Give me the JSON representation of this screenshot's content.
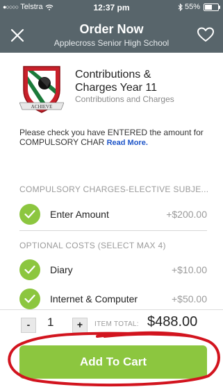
{
  "status": {
    "carrier": "Telstra",
    "time": "12:37 pm",
    "battery": "55%",
    "battery_level": 0.55
  },
  "header": {
    "title": "Order Now",
    "subtitle": "Applecross Senior High School"
  },
  "product": {
    "title_line1": "Contributions &",
    "title_line2": "Charges Year 11",
    "subtitle": "Contributions and Charges",
    "logo_text": "ACHIEVE"
  },
  "notice": {
    "text": "Please check you have ENTERED the amount for COMPULSORY CHAR ",
    "read_more": "Read More."
  },
  "sections": [
    {
      "title": "COMPULSORY CHARGES-ELECTIVE SUBJE..."
    },
    {
      "title": "OPTIONAL COSTS (SELECT MAX 4)"
    }
  ],
  "items": [
    {
      "label": "Enter Amount",
      "price": "+$200.00"
    },
    {
      "label": "Diary",
      "price": "+$10.00"
    },
    {
      "label": "Internet & Computer",
      "price": "+$50.00"
    }
  ],
  "footer": {
    "minus": "-",
    "quantity": "1",
    "plus": "+",
    "item_total_label": "ITEM TOTAL:",
    "item_total": "$488.00"
  },
  "cart": {
    "label": "Add To Cart"
  },
  "colors": {
    "header": "#58656b",
    "accent": "#8cc63f",
    "link": "#1e55c8",
    "annotation": "#d2141e"
  }
}
